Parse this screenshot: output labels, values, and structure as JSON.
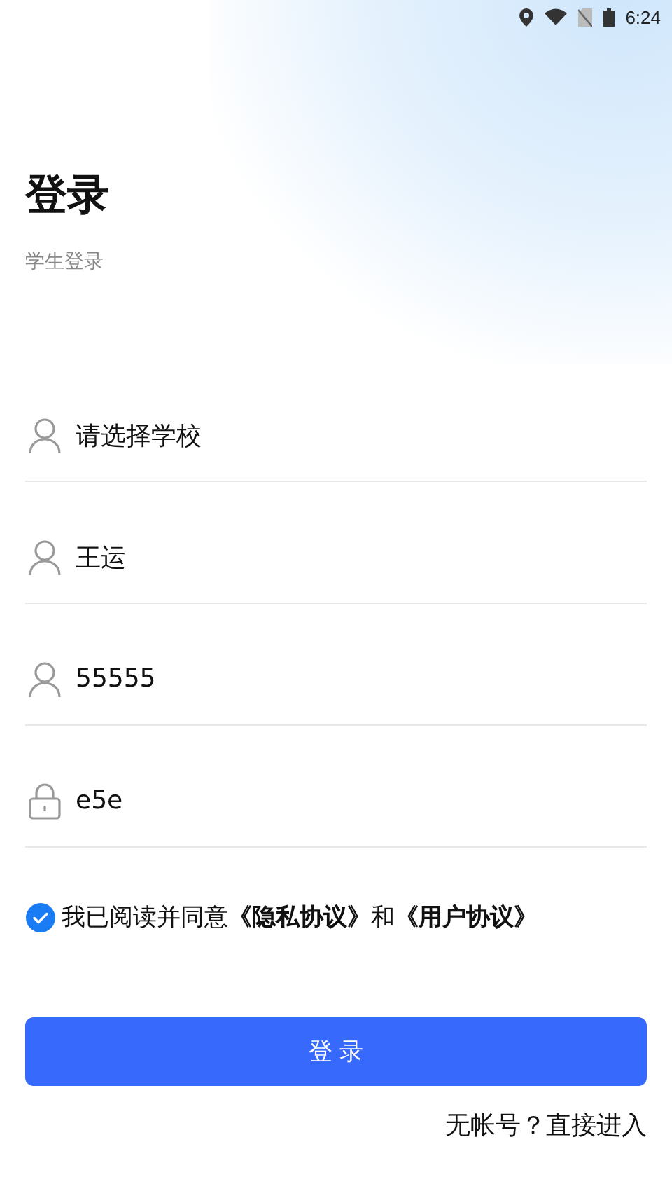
{
  "status_bar": {
    "time": "6:24"
  },
  "title": "登录",
  "subtitle": "学生登录",
  "fields": [
    {
      "kind": "user",
      "value": "请选择学校"
    },
    {
      "kind": "user",
      "value": "王运"
    },
    {
      "kind": "user",
      "value": "55555"
    },
    {
      "kind": "lock",
      "value": "e5e"
    }
  ],
  "agreement": {
    "checked": true,
    "parts": [
      {
        "kind": "text",
        "text": "我已阅读并同意"
      },
      {
        "kind": "link",
        "text": "《隐私协议》"
      },
      {
        "kind": "text",
        "text": "和"
      },
      {
        "kind": "link",
        "text": "《用户协议》"
      }
    ]
  },
  "login_button": "登 录",
  "guest_link": "无帐号？直接进入"
}
